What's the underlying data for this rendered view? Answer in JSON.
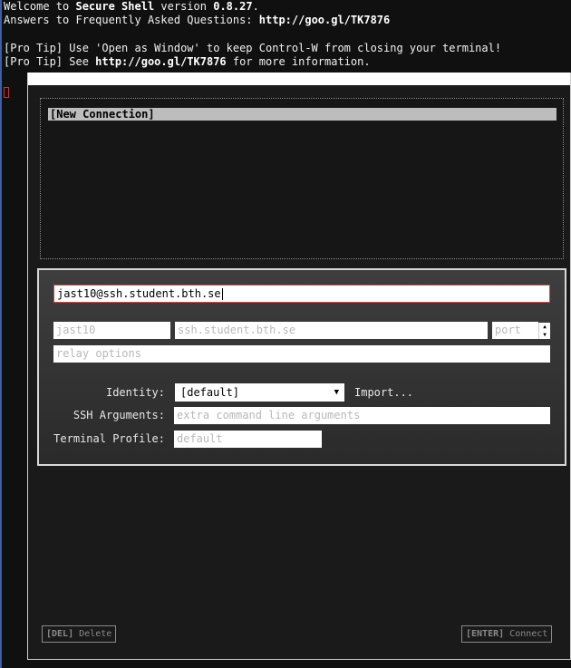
{
  "terminal": {
    "welcome_prefix": "Welcome to ",
    "app_name": "Secure Shell",
    "version_label": " version ",
    "version": "0.8.27",
    "version_suffix": ".",
    "faq_prefix": "Answers to Frequently Asked Questions: ",
    "faq_url": "http://goo.gl/TK7876",
    "tip1": "[Pro Tip] Use 'Open as Window' to keep Control-W from closing your terminal!",
    "tip2_prefix": "[Pro Tip] See ",
    "tip2_url": "http://goo.gl/TK7876",
    "tip2_suffix": " for more information."
  },
  "connections": {
    "items": [
      {
        "label": "[New Connection]",
        "selected": true
      }
    ]
  },
  "form": {
    "destination_value": "jast10@ssh.student.bth.se",
    "username_value": "jast10",
    "hostname_value": "ssh.student.bth.se",
    "port_placeholder": "port",
    "relay_placeholder": "relay options",
    "identity_label": "Identity:",
    "identity_value": "[default]",
    "import_label": "Import...",
    "ssh_args_label": "SSH Arguments:",
    "ssh_args_placeholder": "extra command line arguments",
    "terminal_profile_label": "Terminal Profile:",
    "terminal_profile_placeholder": "default"
  },
  "buttons": {
    "delete_key": "[DEL]",
    "delete_label": " Delete",
    "connect_key": "[ENTER]",
    "connect_label": " Connect"
  },
  "colors": {
    "selection": "#bdbdbd",
    "focus_border": "#d04848",
    "background": "#101010"
  },
  "icons": [
    "chevron-down-icon",
    "spinner-up-icon",
    "spinner-down-icon"
  ]
}
